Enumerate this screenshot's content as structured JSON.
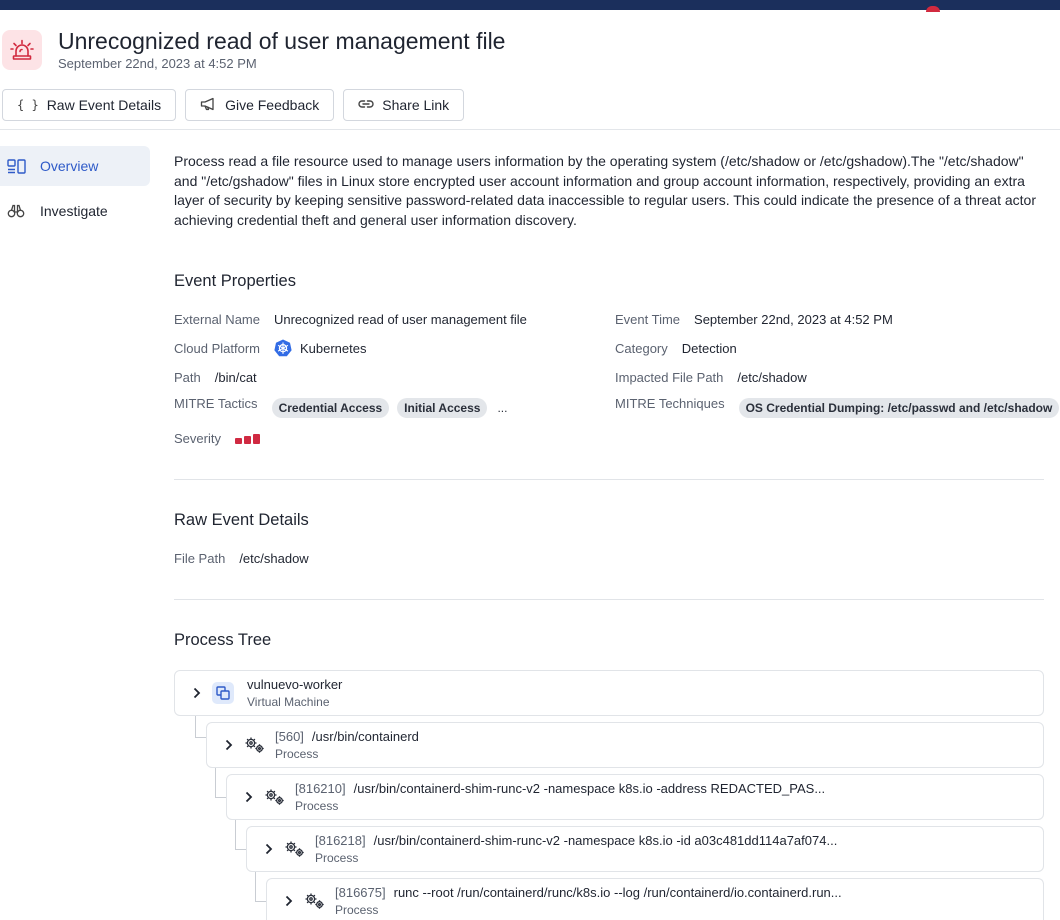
{
  "header": {
    "title": "Unrecognized read of user management file",
    "timestamp": "September 22nd, 2023 at 4:52 PM",
    "icon": "alarm-siren-icon",
    "accent_color": "#d22a3f"
  },
  "actions": [
    {
      "label": "Raw Event Details",
      "icon": "braces-icon"
    },
    {
      "label": "Give Feedback",
      "icon": "megaphone-icon"
    },
    {
      "label": "Share Link",
      "icon": "link-icon"
    }
  ],
  "sidenav": [
    {
      "label": "Overview",
      "icon": "overview-icon",
      "active": true
    },
    {
      "label": "Investigate",
      "icon": "binoculars-icon",
      "active": false
    }
  ],
  "description": "Process read a file resource used to manage users information by the operating system (/etc/shadow or /etc/gshadow).The \"/etc/shadow\" and \"/etc/gshadow\" files in Linux store encrypted user account information and group account information, respectively, providing an extra layer of security by keeping sensitive password-related data inaccessible to regular users. This could indicate the presence of a threat actor achieving credential theft and general user information discovery.",
  "event_properties": {
    "title": "Event Properties",
    "external_name": {
      "label": "External Name",
      "value": "Unrecognized read of user management file"
    },
    "event_time": {
      "label": "Event Time",
      "value": "September 22nd, 2023 at 4:52 PM"
    },
    "cloud_platform": {
      "label": "Cloud Platform",
      "value": "Kubernetes",
      "icon": "kubernetes-icon"
    },
    "category": {
      "label": "Category",
      "value": "Detection"
    },
    "path": {
      "label": "Path",
      "value": "/bin/cat"
    },
    "impacted_file_path": {
      "label": "Impacted File Path",
      "value": "/etc/shadow"
    },
    "mitre_tactics": {
      "label": "MITRE Tactics",
      "values": [
        "Credential Access",
        "Initial Access"
      ],
      "more": "..."
    },
    "mitre_techniques": {
      "label": "MITRE Techniques",
      "values": [
        "OS Credential Dumping: /etc/passwd and /etc/shadow"
      ]
    },
    "severity": {
      "label": "Severity",
      "level": 3,
      "max": 3,
      "color": "#d02a42"
    }
  },
  "raw_event_details": {
    "title": "Raw Event Details",
    "file_path": {
      "label": "File Path",
      "value": "/etc/shadow"
    }
  },
  "process_tree": {
    "title": "Process Tree",
    "nodes": [
      {
        "pid": "",
        "name": "vulnuevo-worker",
        "type": "Virtual Machine",
        "icon": "virtual-machine-icon"
      },
      {
        "pid": "[560]",
        "name": "/usr/bin/containerd",
        "type": "Process",
        "icon": "gears-icon"
      },
      {
        "pid": "[816210]",
        "name": "/usr/bin/containerd-shim-runc-v2 -namespace k8s.io -address REDACTED_PAS...",
        "type": "Process",
        "icon": "gears-icon"
      },
      {
        "pid": "[816218]",
        "name": "/usr/bin/containerd-shim-runc-v2 -namespace k8s.io -id a03c481dd114a7af074...",
        "type": "Process",
        "icon": "gears-icon"
      },
      {
        "pid": "[816675]",
        "name": "runc --root /run/containerd/runc/k8s.io --log /run/containerd/io.containerd.run...",
        "type": "Process",
        "icon": "gears-icon"
      }
    ]
  }
}
